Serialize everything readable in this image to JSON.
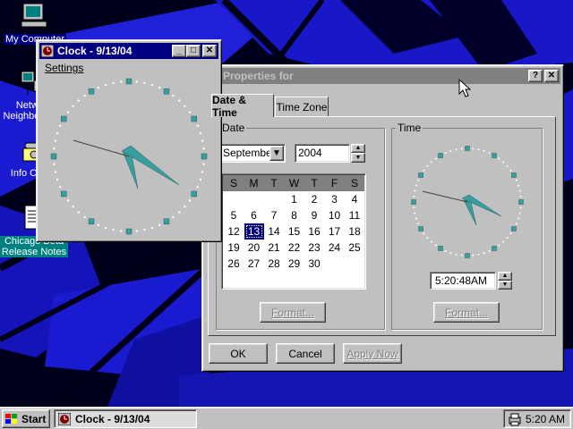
{
  "desktop": {
    "icons": [
      {
        "name": "my-computer",
        "label": "My Computer"
      },
      {
        "name": "network-neighborhood",
        "label": "Network Neighborhood"
      },
      {
        "name": "info-center",
        "label": "Info Center"
      },
      {
        "name": "chicago-beta-release-notes",
        "label": "Chicago Beta Release Notes"
      }
    ]
  },
  "clock_window": {
    "title": "Clock - 9/13/04",
    "menu_settings": "Settings",
    "minimize": "_",
    "maximize": "□",
    "close": "✕"
  },
  "properties": {
    "title": "Properties for",
    "help": "?",
    "close": "✕",
    "tabs": [
      {
        "label": "Date & Time",
        "active": true
      },
      {
        "label": "Time Zone",
        "active": false
      }
    ],
    "date_group": "Date",
    "time_group": "Time",
    "month_value": "September",
    "year_value": "2004",
    "weekdays": [
      "S",
      "M",
      "T",
      "W",
      "T",
      "F",
      "S"
    ],
    "weeks": [
      [
        "",
        "",
        "",
        "1",
        "2",
        "3",
        "4"
      ],
      [
        "5",
        "6",
        "7",
        "8",
        "9",
        "10",
        "11"
      ],
      [
        "12",
        "13",
        "14",
        "15",
        "16",
        "17",
        "18"
      ],
      [
        "19",
        "20",
        "21",
        "22",
        "23",
        "24",
        "25"
      ],
      [
        "26",
        "27",
        "28",
        "29",
        "30",
        "",
        ""
      ]
    ],
    "selected_day": "13",
    "time_value": "5:20:48AM",
    "format_date": "Format...",
    "format_time": "Format...",
    "ok": "OK",
    "cancel": "Cancel",
    "apply": "Apply Now"
  },
  "taskbar": {
    "start": "Start",
    "task_clock": "Clock - 9/13/04",
    "tray_time": "5:20 AM"
  },
  "colors": {
    "desktop_blue": "#1818c8",
    "title_active": "#000080",
    "clock_hand": "#3a9e9e",
    "selection": "#000080"
  }
}
